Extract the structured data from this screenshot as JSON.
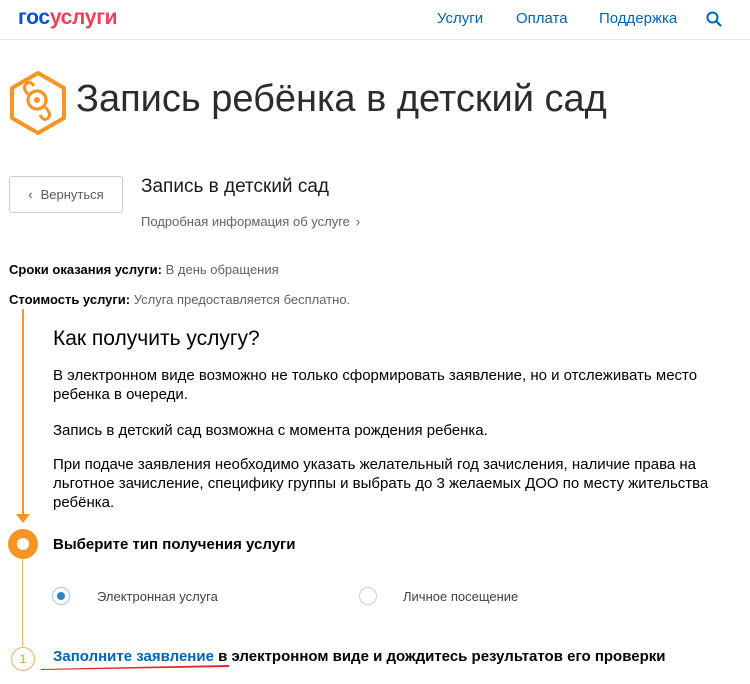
{
  "header": {
    "logo_part1": "гос",
    "logo_part2": "услуги",
    "nav": [
      "Услуги",
      "Оплата",
      "Поддержка"
    ]
  },
  "page": {
    "title": "Запись ребёнка в детский сад"
  },
  "service": {
    "back_label": "Вернуться",
    "title": "Запись в детский сад",
    "more_label": "Подробная информация об услуге"
  },
  "meta": {
    "terms_label": "Сроки оказания услуги:",
    "terms_value": "В день обращения",
    "cost_label": "Стоимость услуги:",
    "cost_value": "Услуга предоставляется бесплатно."
  },
  "how": {
    "heading": "Как получить услугу?",
    "paragraphs": [
      "В электронном виде возможно не только сформировать заявление, но и отслеживать место ребенка в очереди.",
      "Запись в детский сад возможна с момента рождения ребенка.",
      "При подаче заявления необходимо указать желательный год зачисления, наличие права на льготное зачисление, специфику группы и выбрать до 3 желаемых ДОО по месту жительства ребёнка."
    ]
  },
  "receipt": {
    "heading": "Выберите тип получения услуги",
    "options": [
      {
        "label": "Электронная услуга",
        "selected": true
      },
      {
        "label": "Личное посещение",
        "selected": false
      }
    ]
  },
  "steps": [
    {
      "number": "1",
      "link_text": "Заполните заявление",
      "rest_text": " в электронном виде и дождитесь результатов его проверки"
    }
  ],
  "colors": {
    "accent_orange": "#f79426",
    "link_blue": "#0065b1",
    "logo_blue": "#0d4cd3",
    "logo_red": "#ee3f58",
    "annotation_red": "#e3262b"
  }
}
